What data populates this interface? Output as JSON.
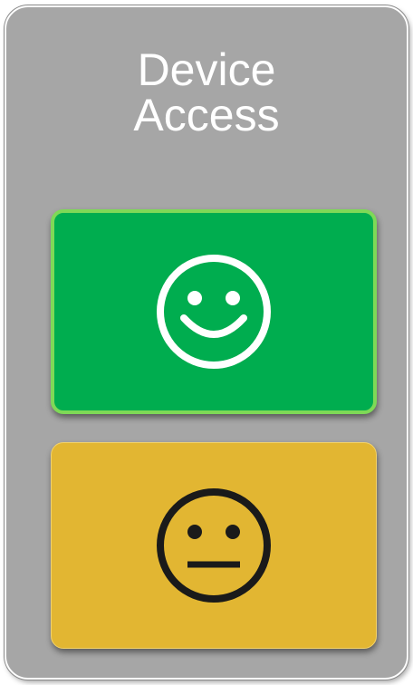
{
  "panel": {
    "title_line1": "Device",
    "title_line2": "Access"
  },
  "status_cards": [
    {
      "icon": "happy-face-icon",
      "color": "#00ad4f",
      "border_color": "#7ed957",
      "icon_color": "#ffffff"
    },
    {
      "icon": "neutral-face-icon",
      "color": "#e2b632",
      "border_color": "#f3d26a",
      "icon_color": "#1a1a1a"
    }
  ]
}
